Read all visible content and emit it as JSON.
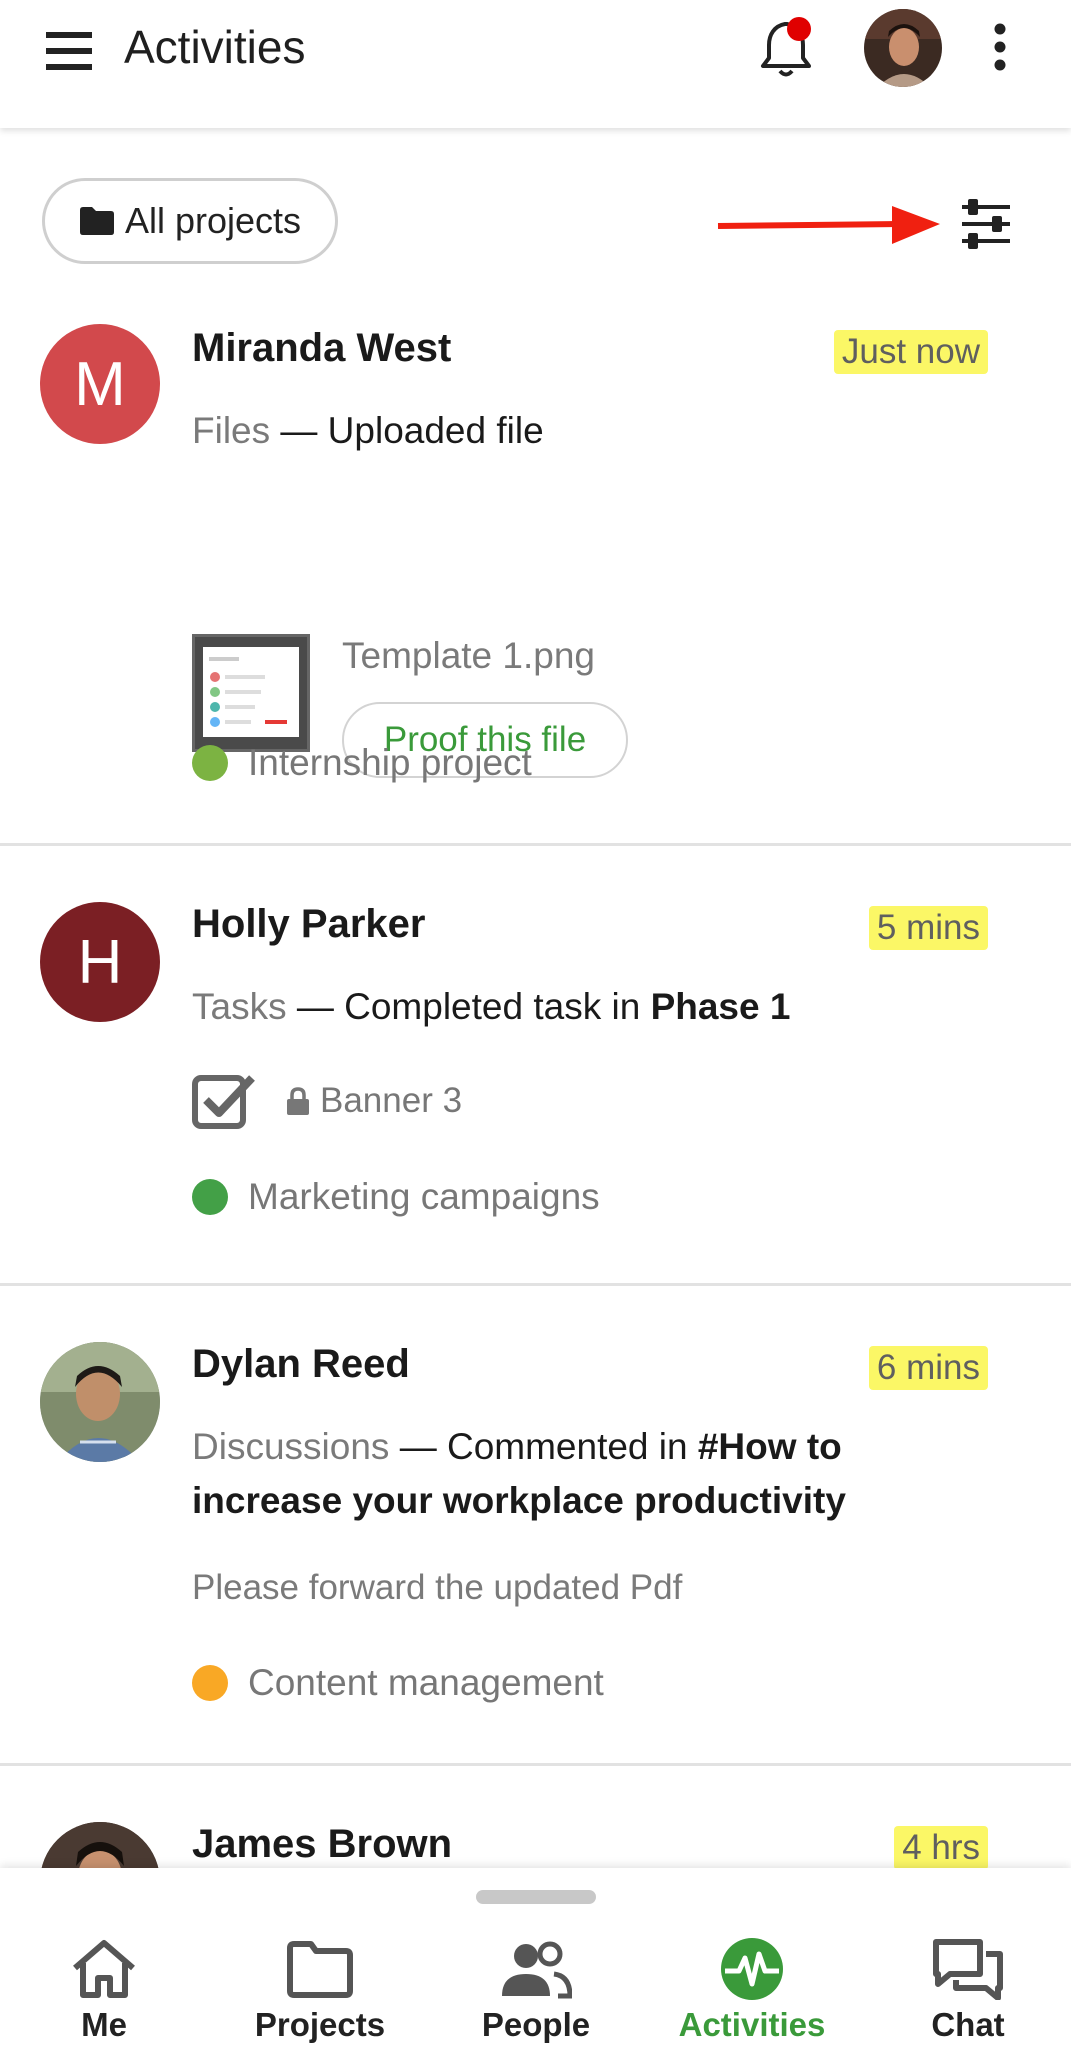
{
  "header": {
    "title": "Activities",
    "notification_dot_color": "#e00000"
  },
  "filter": {
    "all_projects_label": "All projects"
  },
  "activities": [
    {
      "initial": "M",
      "avatar_color": "#d2494c",
      "name": "Miranda West",
      "time": "Just now",
      "module": "Files",
      "action": "— Uploaded file",
      "file_name": "Template 1.png",
      "proof_label": "Proof this file",
      "project": "Internship project",
      "project_color": "#7cb342"
    },
    {
      "initial": "H",
      "avatar_color": "#7b1f24",
      "name": "Holly Parker",
      "time": "5 mins",
      "module": "Tasks",
      "action": "— Completed task in",
      "action_bold": "Phase 1",
      "task_name": "Banner 3",
      "project": "Marketing campaigns",
      "project_color": "#43a047"
    },
    {
      "name": "Dylan Reed",
      "time": "6 mins",
      "module": "Discussions",
      "action": "— Commented in",
      "action_bold": "#How to increase your workplace productivity",
      "comment": "Please forward the updated Pdf",
      "project": "Content management",
      "project_color": "#f9a825"
    },
    {
      "name": "James Brown",
      "time": "4 hrs"
    }
  ],
  "nav": {
    "items": [
      {
        "label": "Me",
        "icon": "home-icon"
      },
      {
        "label": "Projects",
        "icon": "folder-icon"
      },
      {
        "label": "People",
        "icon": "people-icon"
      },
      {
        "label": "Activities",
        "icon": "activity-pulse-icon"
      },
      {
        "label": "Chat",
        "icon": "chat-icon"
      }
    ],
    "active_color": "#3a9a3a"
  }
}
